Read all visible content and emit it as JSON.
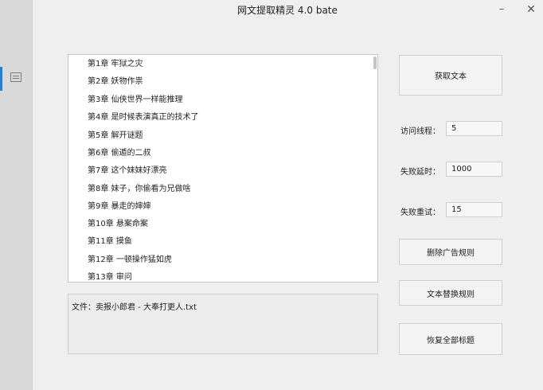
{
  "window": {
    "title": "网文提取精灵 4.0 bate",
    "minimize_glyph": "–",
    "close_glyph": "✕"
  },
  "sidebar": {
    "icon": "list-icon",
    "accent_color": "#2b7cd3"
  },
  "chapters": [
    "第1章 牢狱之灾",
    "第2章 妖物作祟",
    "第3章 仙侠世界一样能推理",
    "第4章 是时候表演真正的技术了",
    "第5章 解开谜题",
    "第6章 偷遁的二叔",
    "第7章 这个妹妹好漂亮",
    "第8章 妹子，你偷看为兄做啥",
    "第9章 暴走的婶婶",
    "第10章 悬案命案",
    "第11章 摸鱼",
    "第12章 一顿操作猛如虎",
    "第13章 审问"
  ],
  "file_info": "文件：卖报小郎君 - 大奉打更人.txt",
  "buttons": {
    "fetch": "获取文本",
    "ad_rules": "删除广告规则",
    "replace_rules": "文本替换规则",
    "restore_titles": "恢复全部标题"
  },
  "settings": {
    "threads_label": "访问线程：",
    "threads_value": "5",
    "delay_label": "失败延时：",
    "delay_value": "1000",
    "retry_label": "失败重试：",
    "retry_value": "15"
  }
}
